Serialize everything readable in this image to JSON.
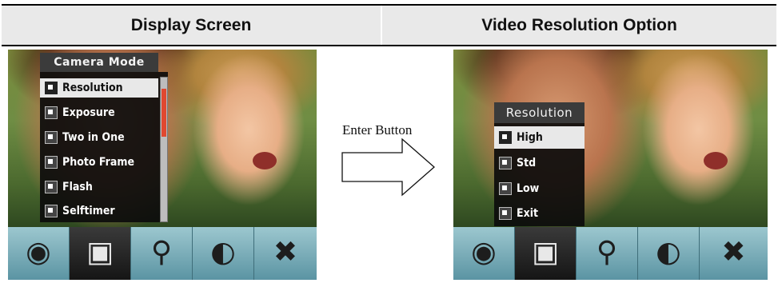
{
  "header": {
    "left_title": "Display Screen",
    "right_title": "Video Resolution Option"
  },
  "left_screen": {
    "menu_title": "Camera Mode",
    "items": [
      {
        "label": "Resolution",
        "icon": "resolution-icon",
        "selected": true
      },
      {
        "label": "Exposure",
        "icon": "exposure-icon",
        "selected": false
      },
      {
        "label": "Two in One",
        "icon": "two-in-one-icon",
        "selected": false
      },
      {
        "label": "Photo Frame",
        "icon": "photo-frame-icon",
        "selected": false
      },
      {
        "label": "Flash",
        "icon": "flash-icon",
        "selected": false
      },
      {
        "label": "Selftimer",
        "icon": "selftimer-icon",
        "selected": false
      }
    ],
    "toolbar": [
      {
        "icon": "film-reel-icon",
        "active": false
      },
      {
        "icon": "camera-icon",
        "active": true
      },
      {
        "icon": "microphone-icon",
        "active": false
      },
      {
        "icon": "palette-icon",
        "active": false
      },
      {
        "icon": "tools-icon",
        "active": false
      }
    ]
  },
  "arrow": {
    "label": "Enter Button"
  },
  "right_screen": {
    "menu_title": "Resolution",
    "items": [
      {
        "label": "High",
        "icon": "high-icon",
        "selected": true
      },
      {
        "label": "Std",
        "icon": "std-icon",
        "selected": false
      },
      {
        "label": "Low",
        "icon": "low-icon",
        "selected": false
      },
      {
        "label": "Exit",
        "icon": "exit-icon",
        "selected": false
      }
    ],
    "toolbar": [
      {
        "icon": "film-reel-icon",
        "active": false
      },
      {
        "icon": "camera-icon",
        "active": true
      },
      {
        "icon": "microphone-icon",
        "active": false
      },
      {
        "icon": "palette-icon",
        "active": false
      },
      {
        "icon": "tools-icon",
        "active": false
      }
    ]
  },
  "colors": {
    "menu_bg": "#0c0c0c",
    "menu_selected_bg": "#e8e8e8",
    "toolbar_bg": "#6fa6b3",
    "scroll_thumb": "#e04830"
  }
}
